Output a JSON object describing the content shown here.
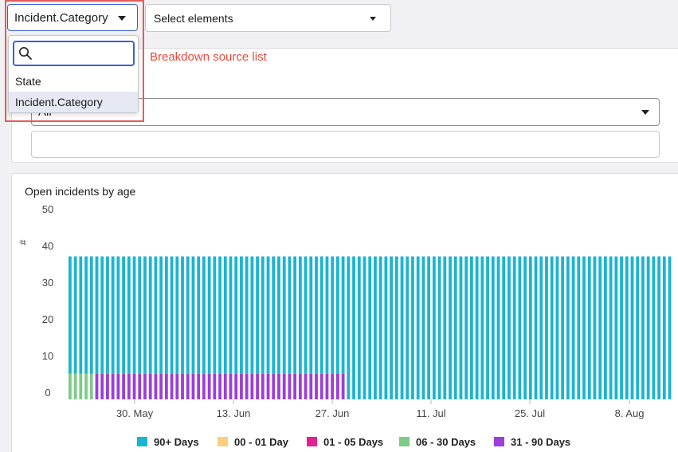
{
  "toolbar": {
    "source_value": "Incident.Category",
    "elements_placeholder": "Select elements"
  },
  "dropdown": {
    "search_value": "",
    "options": [
      "State",
      "Incident.Category"
    ],
    "selected": "Incident.Category"
  },
  "annotation": {
    "label": "Breakdown source list",
    "color": "#e84a3c"
  },
  "filter": {
    "partial_value": "All",
    "text_value": ""
  },
  "chart": {
    "title": "Open incidents by age"
  },
  "chart_data": {
    "type": "bar",
    "stacked": true,
    "ylabel": "#",
    "ylim": [
      0,
      50
    ],
    "yticks": [
      0,
      10,
      20,
      30,
      40,
      50
    ],
    "xtick_labels": [
      "30. May",
      "13. Jun",
      "27. Jun",
      "11. Jul",
      "25. Jul",
      "8. Aug"
    ],
    "bar_count": 113,
    "series": [
      {
        "name": "90+ Days",
        "color": "#19b5d1",
        "segments": [
          {
            "bars": [
              0,
              51
            ],
            "value": 32
          },
          {
            "bars": [
              52,
              112
            ],
            "value": 39
          }
        ]
      },
      {
        "name": "00 - 01 Day",
        "color": "#fbcf7c",
        "segments": []
      },
      {
        "name": "01 - 05 Days",
        "color": "#e31f94",
        "segments": []
      },
      {
        "name": "06 - 30 Days",
        "color": "#7ecb87",
        "segments": [
          {
            "bars": [
              0,
              4
            ],
            "value": 7
          }
        ]
      },
      {
        "name": "31 - 90 Days",
        "color": "#9b3fd8",
        "segments": [
          {
            "bars": [
              5,
              51
            ],
            "value": 7
          }
        ]
      }
    ]
  }
}
